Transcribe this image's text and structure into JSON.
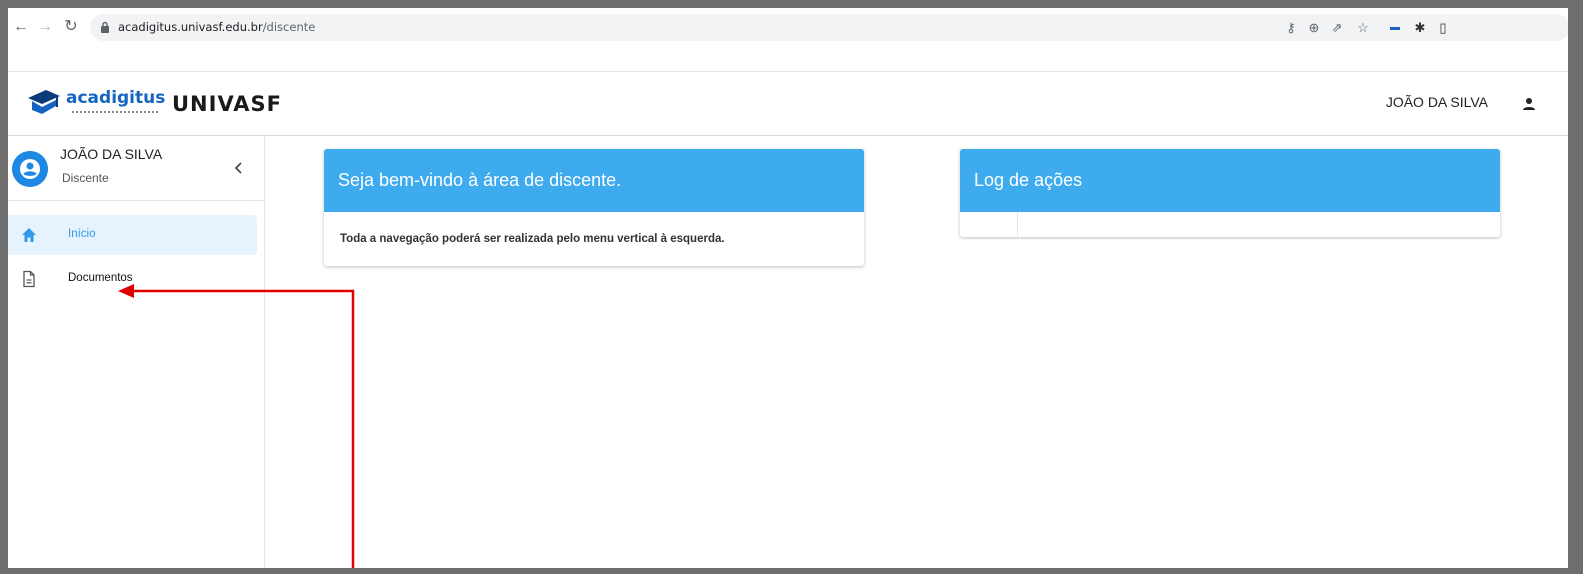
{
  "browser": {
    "url_host": "acadigitus.univasf.edu.br",
    "url_path": "/discente",
    "back_icon": "back-arrow-icon",
    "forward_icon": "forward-arrow-icon",
    "reload_icon": "reload-icon",
    "extensions": [
      "key-icon",
      "zoom-icon",
      "share-icon",
      "star-icon",
      "flag-icon",
      "puzzle-icon",
      "sidebar-icon"
    ]
  },
  "header": {
    "logo_text": "acadigitus",
    "partner_logo_text": "UNIVASF",
    "user_name": "JOÃO DA SILVA",
    "user_icon": "person-icon"
  },
  "sidebar": {
    "profile": {
      "name": "JOÃO DA SILVA",
      "role": "Discente"
    },
    "items": [
      {
        "label": "Início",
        "icon": "home-icon",
        "active": true
      },
      {
        "label": "Documentos",
        "icon": "document-icon",
        "active": false
      }
    ]
  },
  "welcome_card": {
    "title": "Seja bem-vindo à área de discente.",
    "body": "Toda a navegação poderá ser realizada pelo menu vertical à esquerda."
  },
  "log_card": {
    "title": "Log de ações"
  },
  "colors": {
    "primary": "#3fabef",
    "active_bg": "#e6f3fd",
    "annotation": "#e00000"
  }
}
